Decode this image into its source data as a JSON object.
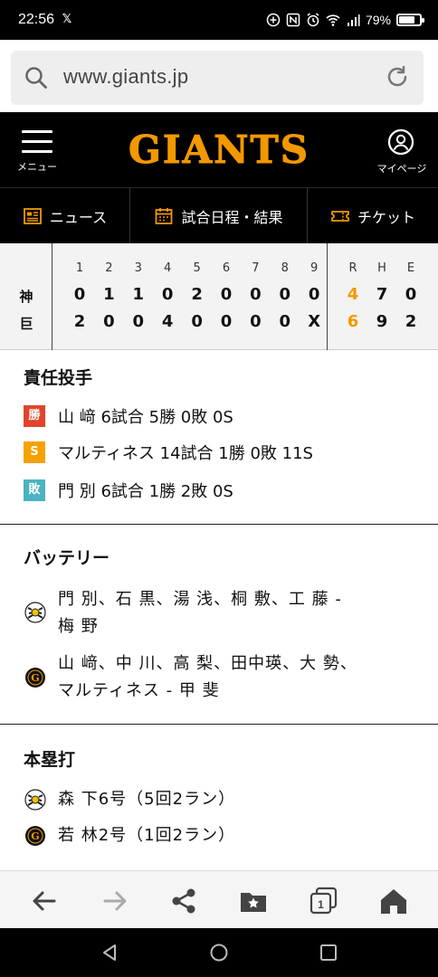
{
  "status_bar": {
    "time": "22:56",
    "battery_text": "79%",
    "battery_level": 0.79
  },
  "url_bar": {
    "url": "www.giants.jp",
    "icons": [
      "search-icon",
      "reload-icon"
    ]
  },
  "site_header": {
    "logo_text": "GIANTS",
    "menu_label": "メニュー",
    "mypage_label": "マイページ",
    "brand_color": "#f39800"
  },
  "subnav": {
    "items": [
      {
        "label": "ニュース",
        "icon": "news-icon"
      },
      {
        "label": "試合日程・結果",
        "icon": "calendar-icon"
      },
      {
        "label": "チケット",
        "icon": "ticket-icon"
      }
    ]
  },
  "scoreboard": {
    "innings": [
      "1",
      "2",
      "3",
      "4",
      "5",
      "6",
      "7",
      "8",
      "9"
    ],
    "totals_headers": [
      "R",
      "H",
      "E"
    ],
    "teams": [
      {
        "name": "神",
        "innings": [
          "0",
          "1",
          "1",
          "0",
          "2",
          "0",
          "0",
          "0",
          "0"
        ],
        "R": "4",
        "H": "7",
        "E": "0"
      },
      {
        "name": "巨",
        "innings": [
          "2",
          "0",
          "0",
          "4",
          "0",
          "0",
          "0",
          "0",
          "X"
        ],
        "R": "6",
        "H": "9",
        "E": "2"
      }
    ]
  },
  "pitchers": {
    "title": "責任投手",
    "rows": [
      {
        "badge": "勝",
        "text": "山 﨑 6試合 5勝 0敗 0S"
      },
      {
        "badge": "S",
        "text": "マルティネス 14試合 1勝 0敗 11S"
      },
      {
        "badge": "敗",
        "text": "門 別 6試合 1勝 2敗 0S"
      }
    ]
  },
  "battery": {
    "title": "バッテリー",
    "tigers_line1": "門 別、石 黒、湯 浅、桐 敷、工 藤 -",
    "tigers_line2": "梅 野",
    "giants_line1": "山 﨑、中 川、高 梨、田中瑛、大 勢、",
    "giants_line2": "マルティネス - 甲 斐"
  },
  "homeruns": {
    "title": "本塁打",
    "tigers": "森 下6号（5回2ラン）",
    "giants": "若 林2号（1回2ラン）"
  },
  "browser_toolbar": {
    "tab_count": "1",
    "icons": [
      "back-arrow-icon",
      "forward-arrow-icon",
      "share-icon",
      "bookmarks-icon",
      "tabs-icon",
      "home-icon"
    ]
  }
}
